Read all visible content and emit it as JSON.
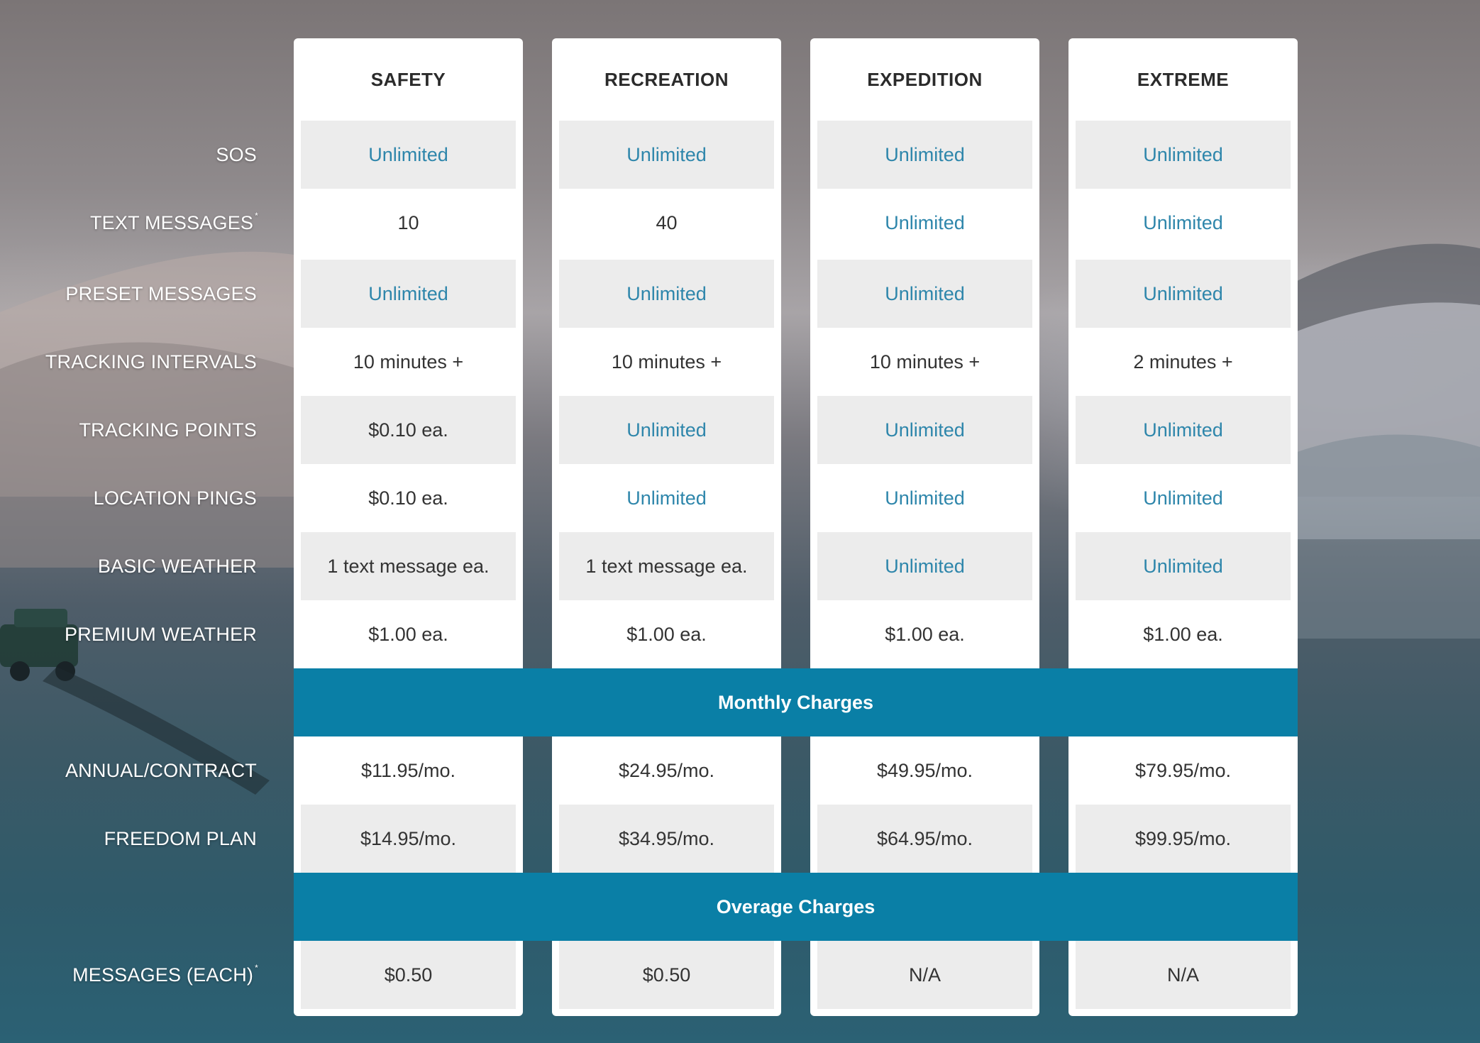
{
  "plans": [
    "SAFETY",
    "RECREATION",
    "EXPEDITION",
    "EXTREME"
  ],
  "features": [
    {
      "label": "SOS",
      "mark": "",
      "values": [
        "Unlimited",
        "Unlimited",
        "Unlimited",
        "Unlimited"
      ]
    },
    {
      "label": "TEXT MESSAGES",
      "mark": "*",
      "values": [
        "10",
        "40",
        "Unlimited",
        "Unlimited"
      ]
    },
    {
      "label": "PRESET MESSAGES",
      "mark": "",
      "values": [
        "Unlimited",
        "Unlimited",
        "Unlimited",
        "Unlimited"
      ]
    },
    {
      "label": "TRACKING INTERVALS",
      "mark": "",
      "values": [
        "10 minutes +",
        "10 minutes +",
        "10 minutes +",
        "2 minutes +"
      ]
    },
    {
      "label": "TRACKING POINTS",
      "mark": "",
      "values": [
        "$0.10 ea.",
        "Unlimited",
        "Unlimited",
        "Unlimited"
      ]
    },
    {
      "label": "LOCATION PINGS",
      "mark": "",
      "values": [
        "$0.10 ea.",
        "Unlimited",
        "Unlimited",
        "Unlimited"
      ]
    },
    {
      "label": "BASIC WEATHER",
      "mark": "",
      "values": [
        "1 text message ea.",
        "1 text message ea.",
        "Unlimited",
        "Unlimited"
      ]
    },
    {
      "label": "PREMIUM WEATHER",
      "mark": "",
      "values": [
        "$1.00 ea.",
        "$1.00 ea.",
        "$1.00 ea.",
        "$1.00 ea."
      ]
    }
  ],
  "monthly": {
    "title": "Monthly Charges",
    "rows": [
      {
        "label": "ANNUAL/CONTRACT",
        "mark": "",
        "values": [
          "$11.95/mo.",
          "$24.95/mo.",
          "$49.95/mo.",
          "$79.95/mo."
        ]
      },
      {
        "label": "FREEDOM PLAN",
        "mark": "",
        "values": [
          "$14.95/mo.",
          "$34.95/mo.",
          "$64.95/mo.",
          "$99.95/mo."
        ]
      }
    ]
  },
  "overage": {
    "title": "Overage Charges",
    "rows": [
      {
        "label": "MESSAGES (EACH)",
        "mark": "*",
        "values": [
          "$0.50",
          "$0.50",
          "N/A",
          "N/A"
        ]
      }
    ]
  },
  "colors": {
    "accent_band": "#0a7fa6",
    "unlimited_text": "#2e86ab",
    "cell_shade": "#ececec"
  }
}
